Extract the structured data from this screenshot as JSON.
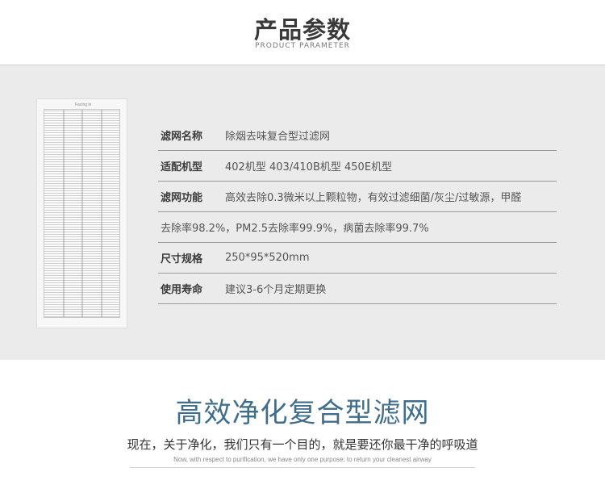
{
  "header": {
    "title": "产品参数",
    "subtitle": "PRODUCT PARAMETER"
  },
  "product_image": {
    "label": "Facing in"
  },
  "specs": [
    {
      "label": "滤网名称",
      "value": "除烟去味复合型过滤网"
    },
    {
      "label": "适配机型",
      "value": "402机型 403/410B机型 450E机型"
    },
    {
      "label": "滤网功能",
      "value": "高效去除0.3微米以上颗粒物，有效过滤细菌/灰尘/过敏源，甲醛"
    },
    {
      "label": "",
      "value": "去除率98.2%，PM2.5去除率99.9%，病菌去除率99.7%"
    },
    {
      "label": "尺寸规格",
      "value": "250*95*520mm"
    },
    {
      "label": "使用寿命",
      "value": "建议3-6个月定期更换"
    }
  ],
  "footer": {
    "title": "高效净化复合型滤网",
    "slogan": "现在，关于净化，我们只有一个目的，就是要还你最干净的呼吸道",
    "slogan_en": "Now, with respect to purification, we have only one purpose: to return your cleanest airway"
  },
  "colors": {
    "accent": "#3f6e8c",
    "panel_bg": "#ebebeb"
  }
}
